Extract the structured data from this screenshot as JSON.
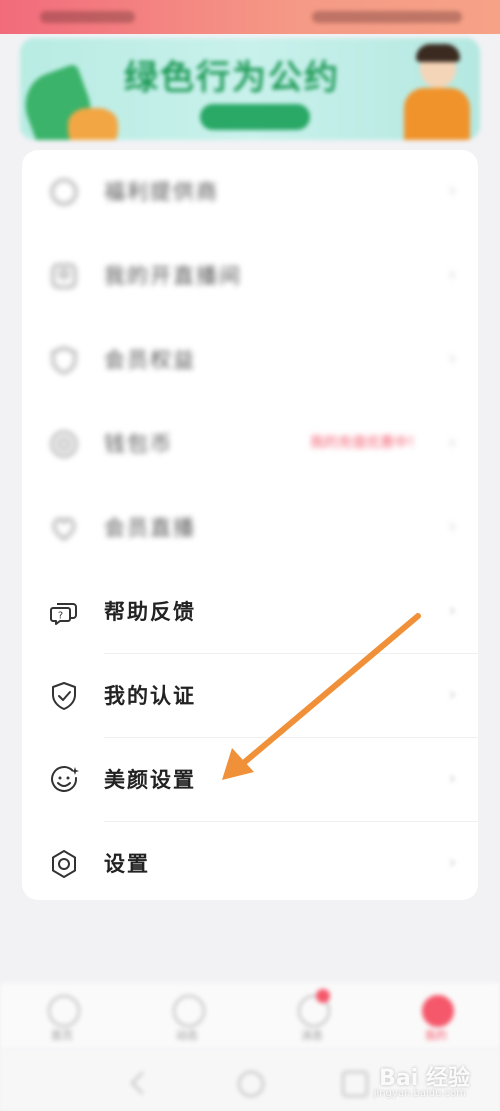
{
  "banner": {
    "title": "绿色行为公约"
  },
  "menu": {
    "items": [
      {
        "label": "福利提供商",
        "icon": "circle-icon"
      },
      {
        "label": "我的开直播间",
        "icon": "user-icon"
      },
      {
        "label": "会员权益",
        "icon": "shield-icon"
      },
      {
        "label": "钱包币",
        "icon": "coin-icon",
        "badge": "我的充值优惠中！"
      },
      {
        "label": "会员直播",
        "icon": "heart-icon"
      },
      {
        "label": "帮助反馈",
        "icon": "help-feedback-icon"
      },
      {
        "label": "我的认证",
        "icon": "shield-check-icon"
      },
      {
        "label": "美颜设置",
        "icon": "beauty-face-icon"
      },
      {
        "label": "设置",
        "icon": "gear-hexagon-icon"
      }
    ],
    "chevron": "›"
  },
  "tabbar": {
    "tabs": [
      {
        "label": "首页"
      },
      {
        "label": "动态"
      },
      {
        "label": "消息"
      },
      {
        "label": "我的"
      }
    ]
  },
  "watermark": {
    "text": "Bai 经验",
    "url": "jingyan.baidu.com"
  },
  "colors": {
    "accent": "#f5586b",
    "arrow": "#f0913a"
  }
}
